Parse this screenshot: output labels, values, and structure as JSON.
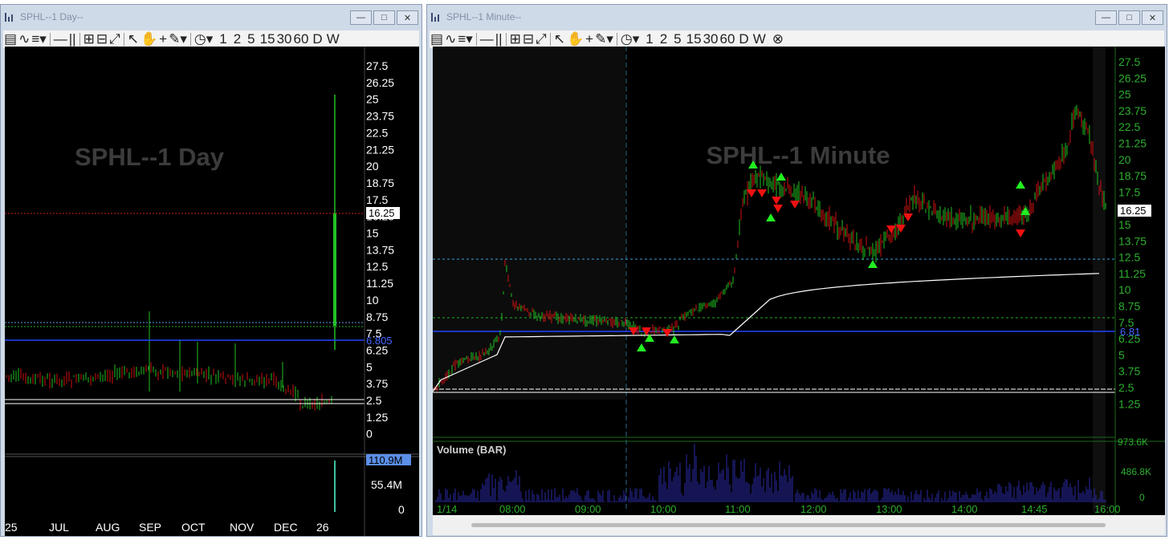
{
  "left_window": {
    "title": "SPHL--1 Day--",
    "watermark": "SPHL--1 Day",
    "toolbar": {
      "periods": [
        "1",
        "2",
        "5",
        "15",
        "30",
        "60",
        "D",
        "W"
      ]
    },
    "price_axis": [
      "27.5",
      "26.25",
      "25",
      "23.75",
      "22.5",
      "21.25",
      "20",
      "18.75",
      "17.5",
      "16.25",
      "15",
      "13.75",
      "12.5",
      "11.25",
      "10",
      "8.75",
      "7.5",
      "6.25",
      "5",
      "3.75",
      "2.5",
      "1.25",
      "0"
    ],
    "last_price": "16.25",
    "level_label": "6.805",
    "volume_axis": [
      "110.9M",
      "55.4M",
      "0"
    ],
    "date_axis": [
      "25",
      "JUL",
      "AUG",
      "SEP",
      "OCT",
      "NOV",
      "DEC",
      "26"
    ]
  },
  "right_window": {
    "title": "SPHL--1 Minute--",
    "watermark": "SPHL--1 Minute",
    "toolbar": {
      "periods": [
        "1",
        "2",
        "5",
        "15",
        "30",
        "60",
        "D",
        "W"
      ]
    },
    "price_axis": [
      "27.5",
      "26.25",
      "25",
      "23.75",
      "22.5",
      "21.25",
      "20",
      "18.75",
      "17.5",
      "16.25",
      "15",
      "13.75",
      "12.5",
      "11.25",
      "10",
      "8.75",
      "7.5",
      "6.25",
      "5",
      "3.75",
      "2.5",
      "1.25"
    ],
    "last_price": "16.25",
    "level_label": "6.81",
    "volume_title": "Volume (BAR)",
    "volume_axis": [
      "973.6K",
      "486.8K",
      "0"
    ],
    "time_axis": [
      "1/14",
      "08:00",
      "09:00",
      "10:00",
      "11:00",
      "12:00",
      "13:00",
      "14:00",
      "14:45",
      "16:00"
    ]
  },
  "colors": {
    "up": "#22c022",
    "down": "#d01010",
    "blue_level": "#2244ff",
    "vwap": "#ffffff",
    "axis_text": "#ffffff",
    "axis_text_green": "#2eae2e",
    "volume_bar": "#2a2aa8"
  }
}
